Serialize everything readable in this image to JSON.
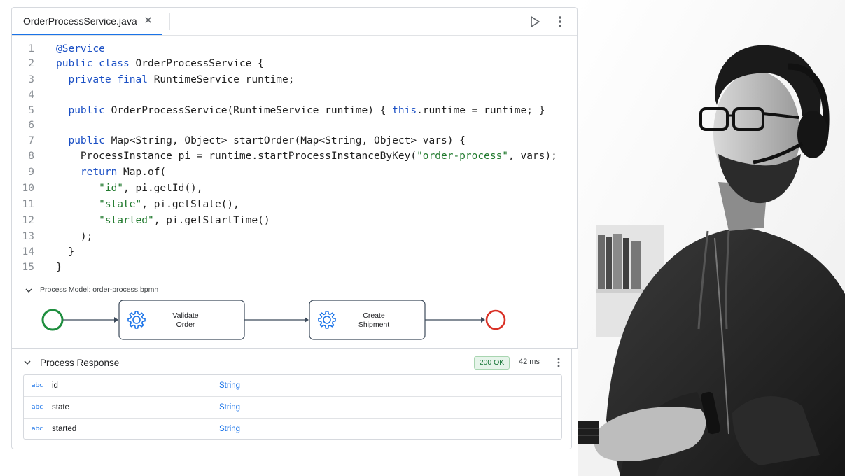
{
  "editor": {
    "tab_title": "OrderProcessService.java",
    "close_glyph": "✕",
    "run_icon": "play-icon",
    "more_icon": "more-vertical-icon",
    "lines": [
      {
        "n": "1",
        "html": "<span class=\"ann\">@Service</span>"
      },
      {
        "n": "2",
        "html": "<span class=\"kw\">public class</span> OrderProcessService {"
      },
      {
        "n": "3",
        "html": "  <span class=\"kw\">private final</span> RuntimeService runtime;"
      },
      {
        "n": "4",
        "html": ""
      },
      {
        "n": "5",
        "html": "  <span class=\"kw\">public</span> OrderProcessService(RuntimeService runtime) { <span class=\"kw\">this</span>.runtime = runtime; }"
      },
      {
        "n": "6",
        "html": ""
      },
      {
        "n": "7",
        "html": "  <span class=\"kw\">public</span> Map&lt;String, Object&gt; startOrder(Map&lt;String, Object&gt; vars) {"
      },
      {
        "n": "8",
        "html": "    ProcessInstance pi = runtime.startProcessInstanceByKey(<span class=\"str\">\"order-process\"</span>, vars);"
      },
      {
        "n": "9",
        "html": "    <span class=\"kw\">return</span> Map.of("
      },
      {
        "n": "10",
        "html": "       <span class=\"str\">\"id\"</span>, pi.getId(),"
      },
      {
        "n": "11",
        "html": "       <span class=\"str\">\"state\"</span>, pi.getState(),"
      },
      {
        "n": "12",
        "html": "       <span class=\"str\">\"started\"</span>, pi.getStartTime()"
      },
      {
        "n": "13",
        "html": "    );"
      },
      {
        "n": "14",
        "html": "  }"
      },
      {
        "n": "15",
        "html": "}"
      }
    ]
  },
  "model": {
    "title": "Process Model: order-process.bpmn",
    "tasks": [
      {
        "line1": "Validate",
        "line2": "Order"
      },
      {
        "line1": "Create",
        "line2": "Shipment"
      }
    ],
    "colors": {
      "start": "#1e8e3e",
      "end": "#d93025",
      "task_border": "#3c4a5a",
      "gear": "#1a73e8"
    }
  },
  "response": {
    "title": "Process Response",
    "status": "200 OK",
    "latency": "42 ms",
    "type_badge": "abc",
    "fields": [
      {
        "name": "id",
        "type": "String"
      },
      {
        "name": "state",
        "type": "String"
      },
      {
        "name": "started",
        "type": "String"
      }
    ]
  }
}
